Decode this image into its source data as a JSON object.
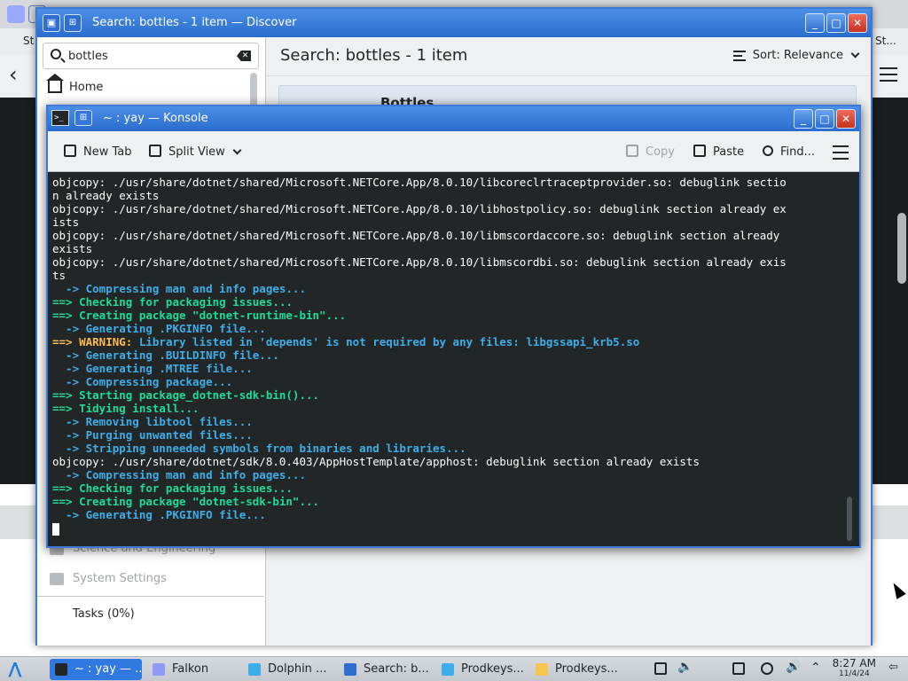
{
  "background_browser": {
    "tab_left_label": "St",
    "tab_right_label": "St..."
  },
  "discover": {
    "title": "Search: bottles - 1 item — Discover",
    "search": {
      "value": "bottles",
      "placeholder": ""
    },
    "nav": {
      "home": "Home",
      "dimmed_items": [
        "Science and Engineering",
        "System Settings"
      ]
    },
    "tasks": "Tasks (0%)",
    "header_title": "Search: bottles - 1 item",
    "sort_label": "Sort: Relevance",
    "result_title": "Bottles"
  },
  "konsole": {
    "title": "~ : yay — Konsole",
    "toolbar": {
      "new_tab": "New Tab",
      "split_view": "Split View",
      "copy": "Copy",
      "paste": "Paste",
      "find": "Find..."
    },
    "lines": [
      {
        "style": "white",
        "text": "objcopy: ./usr/share/dotnet/shared/Microsoft.NETCore.App/8.0.10/libcoreclrtraceptprovider.so: debuglink sectio"
      },
      {
        "style": "white",
        "text": "n already exists"
      },
      {
        "style": "white",
        "text": "objcopy: ./usr/share/dotnet/shared/Microsoft.NETCore.App/8.0.10/libhostpolicy.so: debuglink section already ex"
      },
      {
        "style": "white",
        "text": "ists"
      },
      {
        "style": "white",
        "text": "objcopy: ./usr/share/dotnet/shared/Microsoft.NETCore.App/8.0.10/libmscordaccore.so: debuglink section already"
      },
      {
        "style": "white",
        "text": "exists"
      },
      {
        "style": "white",
        "text": "objcopy: ./usr/share/dotnet/shared/Microsoft.NETCore.App/8.0.10/libmscordbi.so: debuglink section already exis"
      },
      {
        "style": "white",
        "text": "ts"
      },
      {
        "style": "cyan",
        "text": "  -> Compressing man and info pages..."
      },
      {
        "style": "green",
        "text": "==> Checking for packaging issues..."
      },
      {
        "style": "green",
        "text": "==> Creating package \"dotnet-runtime-bin\"..."
      },
      {
        "style": "cyan",
        "text": "  -> Generating .PKGINFO file..."
      },
      {
        "style": "warn",
        "prefix": "==> WARNING: ",
        "text": "Library listed in 'depends' is not required by any files: libgssapi_krb5.so"
      },
      {
        "style": "cyan",
        "text": "  -> Generating .BUILDINFO file..."
      },
      {
        "style": "cyan",
        "text": "  -> Generating .MTREE file..."
      },
      {
        "style": "cyan",
        "text": "  -> Compressing package..."
      },
      {
        "style": "green",
        "text": "==> Starting package_dotnet-sdk-bin()..."
      },
      {
        "style": "green",
        "text": "==> Tidying install..."
      },
      {
        "style": "cyan",
        "text": "  -> Removing libtool files..."
      },
      {
        "style": "cyan",
        "text": "  -> Purging unwanted files..."
      },
      {
        "style": "cyan",
        "text": "  -> Stripping unneeded symbols from binaries and libraries..."
      },
      {
        "style": "white",
        "text": "objcopy: ./usr/share/dotnet/sdk/8.0.403/AppHostTemplate/apphost: debuglink section already exists"
      },
      {
        "style": "cyan",
        "text": "  -> Compressing man and info pages..."
      },
      {
        "style": "green",
        "text": "==> Checking for packaging issues..."
      },
      {
        "style": "green",
        "text": "==> Creating package \"dotnet-sdk-bin\"..."
      },
      {
        "style": "cyan",
        "text": "  -> Generating .PKGINFO file..."
      }
    ]
  },
  "taskbar": {
    "tasks": [
      {
        "label": "~ : yay — ...",
        "active": true,
        "icon": "terminal-icon"
      },
      {
        "label": "Falkon",
        "active": false,
        "icon": "falkon-icon"
      },
      {
        "label": "Dolphin ...",
        "active": false,
        "icon": "folder-icon"
      },
      {
        "label": "Search: b...",
        "active": false,
        "icon": "discover-icon"
      },
      {
        "label": "Prodkeys...",
        "active": false,
        "icon": "folder-icon"
      },
      {
        "label": "Prodkeys...",
        "active": false,
        "icon": "b-icon"
      }
    ],
    "clock_time": "8:27 AM",
    "clock_date": "11/4/24"
  },
  "colors": {
    "accent": "#3079e0",
    "terminal_bg": "#232627",
    "cyan": "#3daee9",
    "green": "#1cdc9a",
    "warning": "#fdbc4b"
  }
}
